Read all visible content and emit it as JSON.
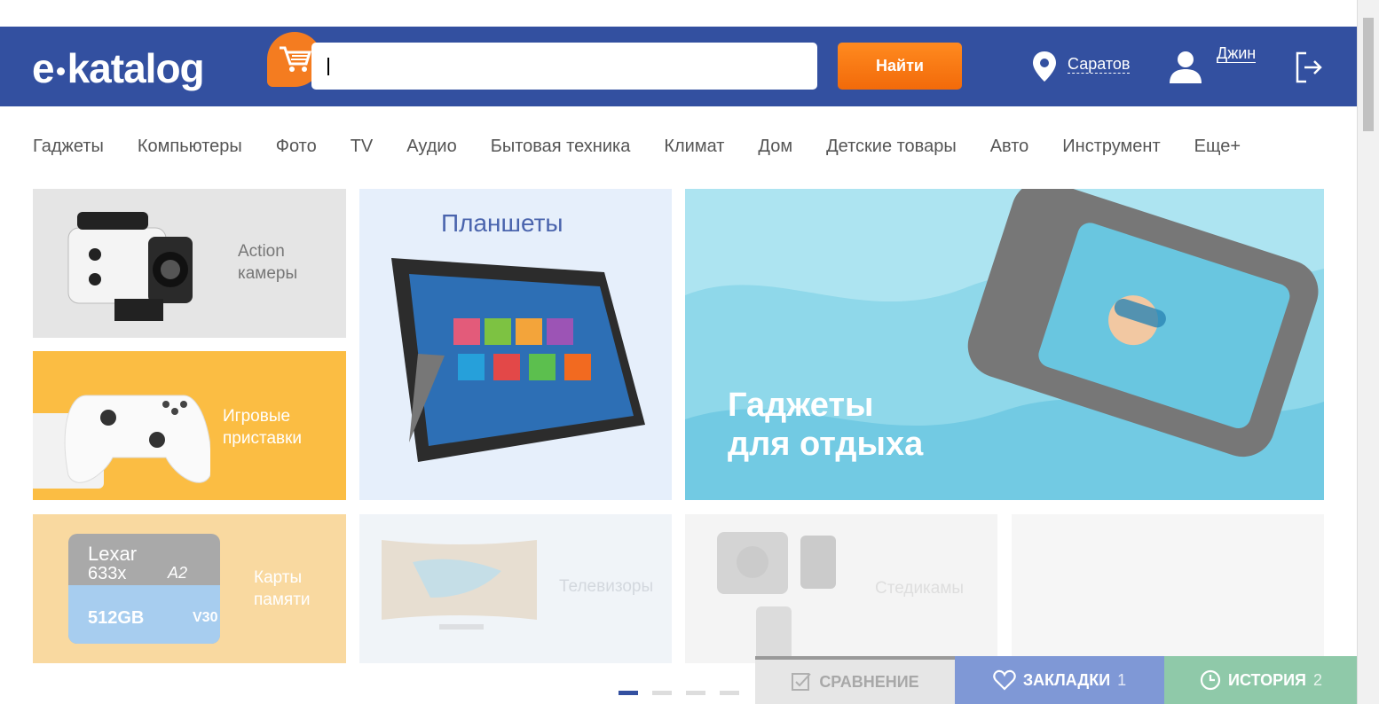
{
  "header": {
    "logo": "e-katalog",
    "logo_left": "e",
    "logo_right": "katalog",
    "search_placeholder": "",
    "search_button": "Найти",
    "city": "Саратов",
    "user": "Джин"
  },
  "nav": [
    "Гаджеты",
    "Компьютеры",
    "Фото",
    "TV",
    "Аудио",
    "Бытовая техника",
    "Климат",
    "Дом",
    "Детские товары",
    "Авто",
    "Инструмент",
    "Еще+"
  ],
  "tiles": {
    "action": [
      "Action",
      "камеры"
    ],
    "consoles": [
      "Игровые",
      "приставки"
    ],
    "tablets": "Планшеты",
    "promo": [
      "Гаджеты",
      "для отдыха"
    ],
    "memory": [
      "Карты",
      "памяти"
    ],
    "tv": "Телевизоры",
    "steadicam": "Стедикамы",
    "microsd_brand": "Lexar",
    "microsd_speed": "633x",
    "microsd_size": "512GB",
    "microsd_class": "A2",
    "microsd_v": "V30"
  },
  "bottom": {
    "compare": "СРАВНЕНИЕ",
    "bookmarks": "ЗАКЛАДКИ",
    "bookmarks_count": "1",
    "history": "ИСТОРИЯ",
    "history_count": "2"
  },
  "colors": {
    "header": "#3350a0",
    "accent": "#f47c20",
    "compare_bg": "#e6e6e6",
    "bookmarks_bg": "#7f98d6",
    "history_bg": "#8fc9a9"
  }
}
